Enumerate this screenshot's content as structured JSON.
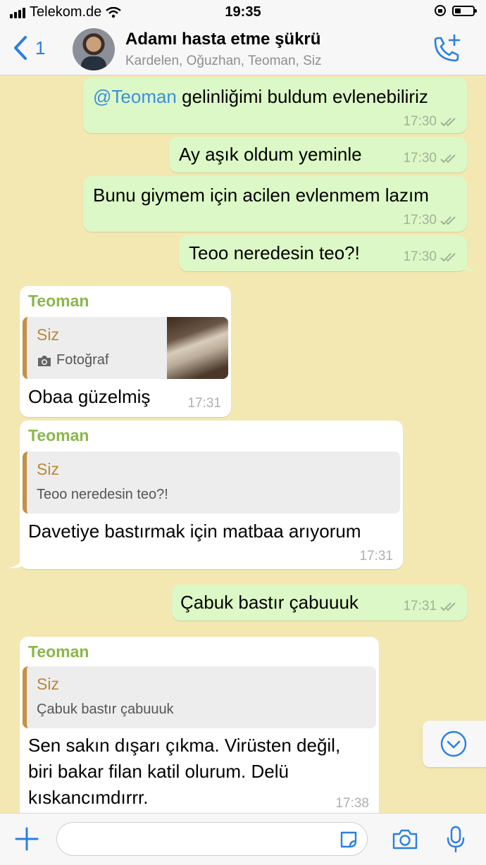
{
  "status_bar": {
    "carrier": "Telekom.de",
    "time": "19:35"
  },
  "header": {
    "back_count": "1",
    "title": "Adamı hasta etme şükrü",
    "subtitle": "Kardelen, Oğuzhan, Teoman, Siz"
  },
  "messages": [
    {
      "type": "out",
      "mention": "@Teoman",
      "text": " gelinliğimi buldum evlenebiliriz",
      "time": "17:30"
    },
    {
      "type": "out",
      "text": "Ay aşık oldum yeminle",
      "time": "17:30"
    },
    {
      "type": "out",
      "text": "Bunu giymem için acilen evlenmem lazım",
      "time": "17:30"
    },
    {
      "type": "out",
      "text": "Teoo neredesin teo?!",
      "time": "17:30"
    },
    {
      "type": "in",
      "sender": "Teoman",
      "quote_name": "Siz",
      "quote_text": "Fotoğraf",
      "text": "Obaa güzelmiş",
      "time": "17:31"
    },
    {
      "type": "in",
      "sender": "Teoman",
      "quote_name": "Siz",
      "quote_text": "Teoo neredesin teo?!",
      "text": "Davetiye bastırmak için matbaa arıyorum",
      "time": "17:31"
    },
    {
      "type": "out",
      "text": "Çabuk bastır çabuuuk",
      "time": "17:31"
    },
    {
      "type": "in",
      "sender": "Teoman",
      "quote_name": "Siz",
      "quote_text": "Çabuk bastır çabuuuk",
      "lines": [
        "Sen sakın dışarı çıkma. Virüsten değil,",
        "biri bakar filan katil olurum. Delü",
        "kıskancımdırrr."
      ],
      "time": "17:38"
    }
  ],
  "colors": {
    "chat_background": "#f3e8b1",
    "outgoing_bubble": "#dcf8c6",
    "incoming_bubble": "#ffffff",
    "accent": "#2b7fe0",
    "sender_name": "#8bb74a",
    "quote_bar": "#c29143"
  },
  "icons": [
    "wifi-icon",
    "battery-icon",
    "back-chevron-icon",
    "add-call-icon",
    "read-ticks-icon",
    "camera-icon",
    "scroll-down-icon",
    "plus-icon",
    "sticker-icon",
    "microphone-icon"
  ]
}
